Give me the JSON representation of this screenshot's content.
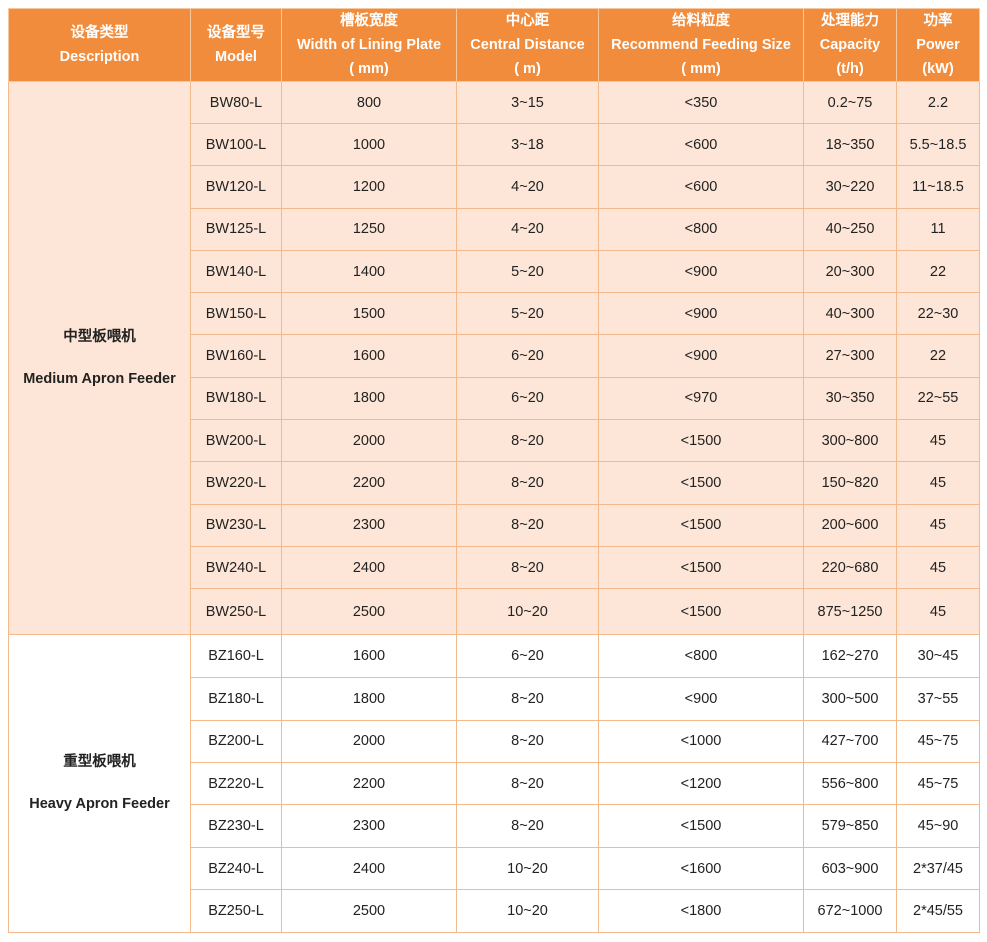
{
  "colors": {
    "header_bg": "#f08c3c",
    "medium_row_bg": "#fde6d7",
    "heavy_row_bg": "#ffffff",
    "border": "#f3b98c"
  },
  "headers": [
    {
      "cn": "设备类型",
      "en": "Description",
      "unit": ""
    },
    {
      "cn": "设备型号",
      "en": "Model",
      "unit": ""
    },
    {
      "cn": "槽板宽度",
      "en": "Width of Lining Plate",
      "unit": "( mm)"
    },
    {
      "cn": "中心距",
      "en": "Central Distance",
      "unit": "( m)"
    },
    {
      "cn": "给料粒度",
      "en": "Recommend Feeding Size",
      "unit": "( mm)"
    },
    {
      "cn": "处理能力",
      "en": "Capacity",
      "unit": "(t/h)"
    },
    {
      "cn": "功率",
      "en": "Power",
      "unit": "(kW)"
    }
  ],
  "groups": [
    {
      "cn": "中型板喂机",
      "en": "Medium Apron Feeder",
      "rows": [
        [
          "BW80-L",
          "800",
          "3~15",
          "<350",
          "0.2~75",
          "2.2"
        ],
        [
          "BW100-L",
          "1000",
          "3~18",
          "<600",
          "18~350",
          "5.5~18.5"
        ],
        [
          "BW120-L",
          "1200",
          "4~20",
          "<600",
          "30~220",
          "11~18.5"
        ],
        [
          "BW125-L",
          "1250",
          "4~20",
          "<800",
          "40~250",
          "11"
        ],
        [
          "BW140-L",
          "1400",
          "5~20",
          "<900",
          "20~300",
          "22"
        ],
        [
          "BW150-L",
          "1500",
          "5~20",
          "<900",
          "40~300",
          "22~30"
        ],
        [
          "BW160-L",
          "1600",
          "6~20",
          "<900",
          "27~300",
          "22"
        ],
        [
          "BW180-L",
          "1800",
          "6~20",
          "<970",
          "30~350",
          "22~55"
        ],
        [
          "BW200-L",
          "2000",
          "8~20",
          "<1500",
          "300~800",
          "45"
        ],
        [
          "BW220-L",
          "2200",
          "8~20",
          "<1500",
          "150~820",
          "45"
        ],
        [
          "BW230-L",
          "2300",
          "8~20",
          "<1500",
          "200~600",
          "45"
        ],
        [
          "BW240-L",
          "2400",
          "8~20",
          "<1500",
          "220~680",
          "45"
        ],
        [
          "BW250-L",
          "2500",
          "10~20",
          "<1500",
          "875~1250",
          "45"
        ]
      ]
    },
    {
      "cn": "重型板喂机",
      "en": "Heavy Apron Feeder",
      "rows": [
        [
          "BZ160-L",
          "1600",
          "6~20",
          "<800",
          "162~270",
          "30~45"
        ],
        [
          "BZ180-L",
          "1800",
          "8~20",
          "<900",
          "300~500",
          "37~55"
        ],
        [
          "BZ200-L",
          "2000",
          "8~20",
          "<1000",
          "427~700",
          "45~75"
        ],
        [
          "BZ220-L",
          "2200",
          "8~20",
          "<1200",
          "556~800",
          "45~75"
        ],
        [
          "BZ230-L",
          "2300",
          "8~20",
          "<1500",
          "579~850",
          "45~90"
        ],
        [
          "BZ240-L",
          "2400",
          "10~20",
          "<1600",
          "603~900",
          "2*37/45"
        ],
        [
          "BZ250-L",
          "2500",
          "10~20",
          "<1800",
          "672~1000",
          "2*45/55"
        ]
      ]
    }
  ]
}
